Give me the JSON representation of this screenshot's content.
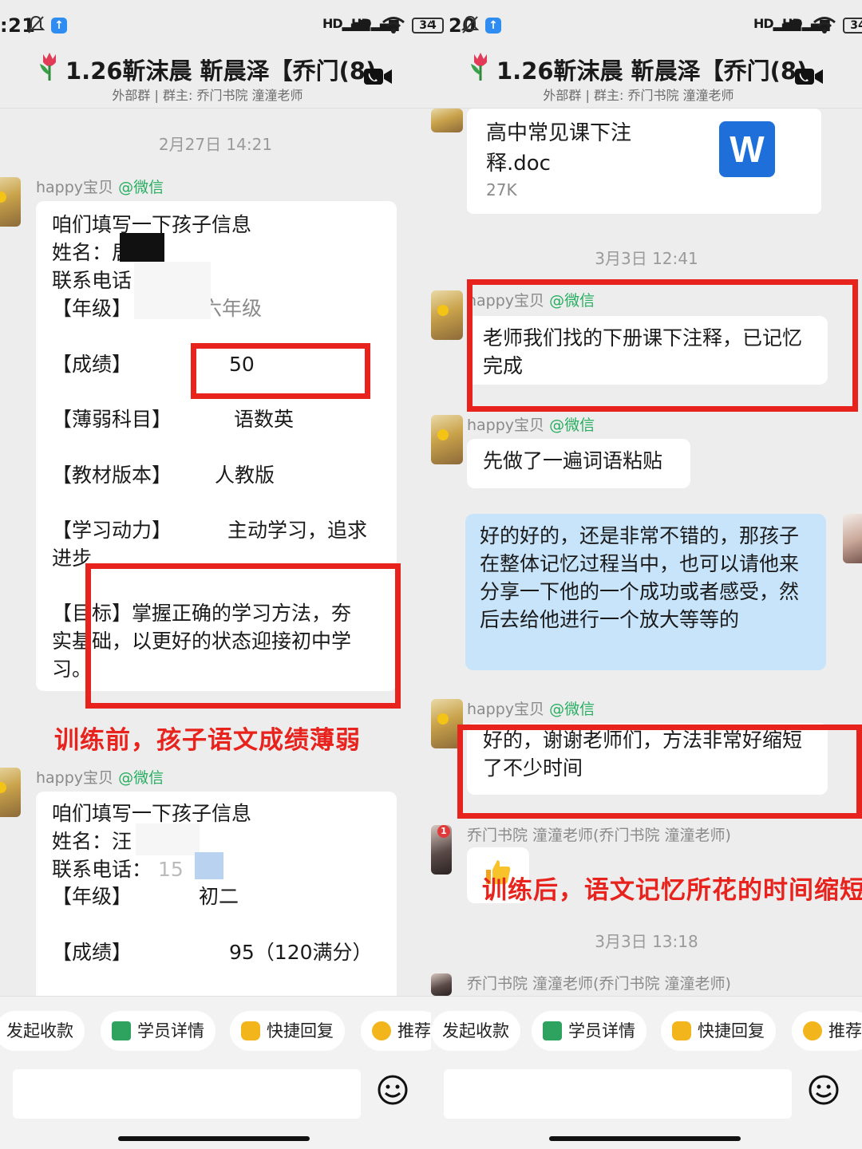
{
  "status": {
    "left_time": ":21",
    "right_time": "20",
    "signal_label": "HD",
    "battery": "34"
  },
  "header": {
    "title": "1.26靳沫晨 靳晨泽【乔门(8)",
    "subtitle": "外部群 | 群主: 乔门书院 潼潼老师"
  },
  "left": {
    "timestamp": "2月27日 14:21",
    "msg1": {
      "sender": "happy宝贝",
      "tag": "@微信",
      "intro": "咱们填写一下孩子信息",
      "name_label": "姓名：",
      "name_char": "居",
      "phone_label": "联系电话",
      "grade_label": "【年级】",
      "grade_value": "六年级",
      "score_label": "【成绩】",
      "score_value": "50",
      "weak_label": "【薄弱科目】",
      "weak_value": "语数英",
      "textbook_label": "【教材版本】",
      "textbook_value": "人教版",
      "motivation_label": "【学习动力】",
      "motivation_value": "主动学习，追求",
      "motivation_cont": "进步",
      "goal_line1": "【目标】掌握正确的学习方法，夯",
      "goal_line2": "实基础，以更好的状态迎接初中学",
      "goal_line3": "习。"
    },
    "caption_before": "训练前，孩子语文成绩薄弱",
    "msg2": {
      "sender": "happy宝贝",
      "tag": "@微信",
      "intro": "咱们填写一下孩子信息",
      "name_label": "姓名：",
      "name_char": "汪",
      "phone_label": "联系电话：",
      "phone_frag": "15",
      "grade_label": "【年级】",
      "grade_value": "初二",
      "score_label": "【成绩】",
      "score_value": "95（120满分）"
    }
  },
  "right": {
    "file": {
      "name": "高中常见课下注释.doc",
      "size": "27K",
      "icon_letter": "W"
    },
    "timestamp1": "3月3日 12:41",
    "msg1": {
      "sender": "happy宝贝",
      "tag": "@微信",
      "text": "老师我们找的下册课下注释，已记忆完成"
    },
    "msg2": {
      "sender": "happy宝贝",
      "tag": "@微信",
      "text": "先做了一遍词语粘贴"
    },
    "reply": {
      "text": "好的好的，还是非常不错的，那孩子在整体记忆过程当中，也可以请他来分享一下他的一个成功或者感受，然后去给他进行一个放大等等的"
    },
    "msg3": {
      "sender": "happy宝贝",
      "tag": "@微信",
      "text": "好的，谢谢老师们，方法非常好缩短了不少时间"
    },
    "teacher1": {
      "sender": "乔门书院 潼潼老师(乔门书院 潼潼老师)",
      "badge": "1"
    },
    "caption_after": "训练后，语文记忆所花的时间缩短",
    "timestamp2": "3月3日 13:18",
    "teacher2": {
      "sender": "乔门书院 潼潼老师(乔门书院 潼潼老师)"
    }
  },
  "quick_actions": [
    "发起收款",
    "学员详情",
    "快捷回复",
    "推荐"
  ],
  "colors": {
    "accent_red": "#e8231d",
    "wechat_green": "#27ae60",
    "reply_blue": "#c8e4fb"
  }
}
